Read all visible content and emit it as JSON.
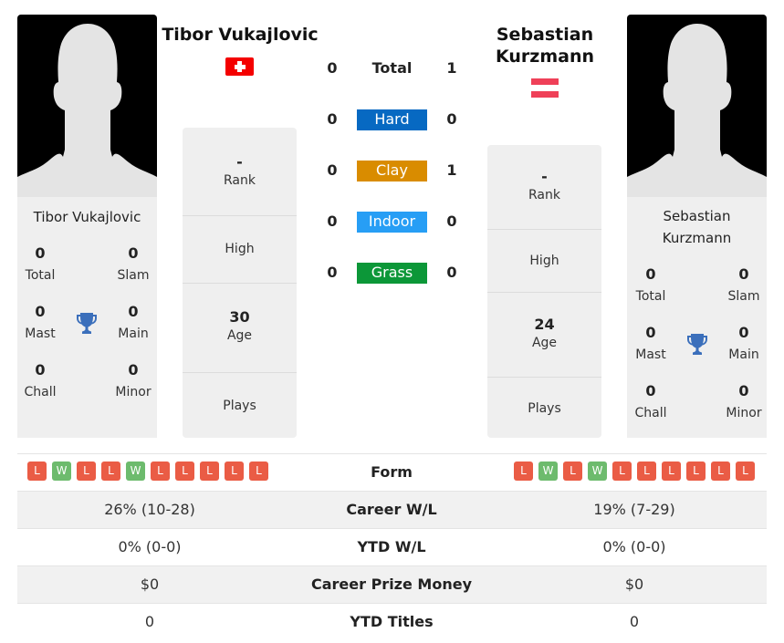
{
  "colors": {
    "hard": "#0769c2",
    "clay": "#d98c00",
    "indoor": "#279ef5",
    "grass": "#0c9738",
    "loss": "#ea5c45",
    "win": "#6dbb6d",
    "trophy": "#3b6fbb"
  },
  "player1": {
    "name": "Tibor Vukajlovic",
    "flag": "switzerland-flag",
    "titles": {
      "total": {
        "value": "0",
        "label": "Total"
      },
      "slam": {
        "value": "0",
        "label": "Slam"
      },
      "mast": {
        "value": "0",
        "label": "Mast"
      },
      "main": {
        "value": "0",
        "label": "Main"
      },
      "chall": {
        "value": "0",
        "label": "Chall"
      },
      "minor": {
        "value": "0",
        "label": "Minor"
      }
    },
    "stats": {
      "rank": {
        "value": "-",
        "label": "Rank"
      },
      "high": {
        "value": "",
        "label": "High"
      },
      "age": {
        "value": "30",
        "label": "Age"
      },
      "plays": {
        "value": "",
        "label": "Plays"
      }
    },
    "form": [
      "L",
      "W",
      "L",
      "L",
      "W",
      "L",
      "L",
      "L",
      "L",
      "L"
    ],
    "career_wl": "26% (10-28)",
    "ytd_wl": "0% (0-0)",
    "career_prize": "$0",
    "ytd_titles": "0"
  },
  "player2": {
    "name": "Sebastian Kurzmann",
    "name_line1": "Sebastian",
    "name_line2": "Kurzmann",
    "flag": "austria-flag",
    "titles": {
      "total": {
        "value": "0",
        "label": "Total"
      },
      "slam": {
        "value": "0",
        "label": "Slam"
      },
      "mast": {
        "value": "0",
        "label": "Mast"
      },
      "main": {
        "value": "0",
        "label": "Main"
      },
      "chall": {
        "value": "0",
        "label": "Chall"
      },
      "minor": {
        "value": "0",
        "label": "Minor"
      }
    },
    "stats": {
      "rank": {
        "value": "-",
        "label": "Rank"
      },
      "high": {
        "value": "",
        "label": "High"
      },
      "age": {
        "value": "24",
        "label": "Age"
      },
      "plays": {
        "value": "",
        "label": "Plays"
      }
    },
    "form": [
      "L",
      "W",
      "L",
      "W",
      "L",
      "L",
      "L",
      "L",
      "L",
      "L"
    ],
    "career_wl": "19% (7-29)",
    "ytd_wl": "0% (0-0)",
    "career_prize": "$0",
    "ytd_titles": "0"
  },
  "h2h": {
    "total": {
      "label": "Total",
      "p1": "0",
      "p2": "1"
    },
    "hard": {
      "label": "Hard",
      "p1": "0",
      "p2": "0"
    },
    "clay": {
      "label": "Clay",
      "p1": "0",
      "p2": "1"
    },
    "indoor": {
      "label": "Indoor",
      "p1": "0",
      "p2": "0"
    },
    "grass": {
      "label": "Grass",
      "p1": "0",
      "p2": "0"
    }
  },
  "table": {
    "form_label": "Form",
    "career_wl_label": "Career W/L",
    "ytd_wl_label": "YTD W/L",
    "career_prize_label": "Career Prize Money",
    "ytd_titles_label": "YTD Titles"
  }
}
